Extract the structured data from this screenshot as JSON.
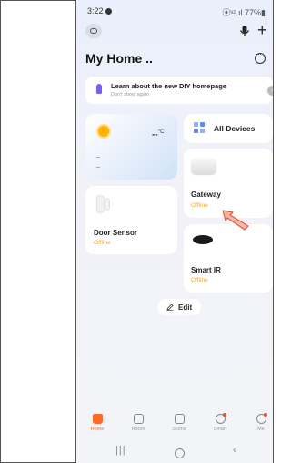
{
  "status_bar": {
    "time": "3:22",
    "right": "⦿ᵛᶻ.ıl 77%▮"
  },
  "header": {
    "title": "My Home .."
  },
  "banner": {
    "title": "Learn about the new DIY homepage",
    "subtitle": "Don't show again"
  },
  "weather": {
    "temperature": "--",
    "unit": "°C"
  },
  "all_devices": {
    "label": "All Devices"
  },
  "devices": [
    {
      "name": "Gateway",
      "status": "Offline"
    },
    {
      "name": "Door Sensor",
      "status": "Offline"
    },
    {
      "name": "Smart IR",
      "status": "Offline"
    }
  ],
  "edit_button": {
    "label": "Edit"
  },
  "tabs": [
    {
      "label": "Home",
      "active": true
    },
    {
      "label": "Room"
    },
    {
      "label": "Scene"
    },
    {
      "label": "Smart"
    },
    {
      "label": "Me"
    }
  ],
  "colors": {
    "accent": "#ff6a2a",
    "offline": "#f5a623",
    "annotation_arrow": "#e8553f"
  },
  "icons": {
    "topbar": [
      "device-chip-icon",
      "mic-icon",
      "plus-icon",
      "more-icon"
    ],
    "nav": [
      "recent-apps-icon",
      "home-circle-icon",
      "back-icon"
    ]
  }
}
